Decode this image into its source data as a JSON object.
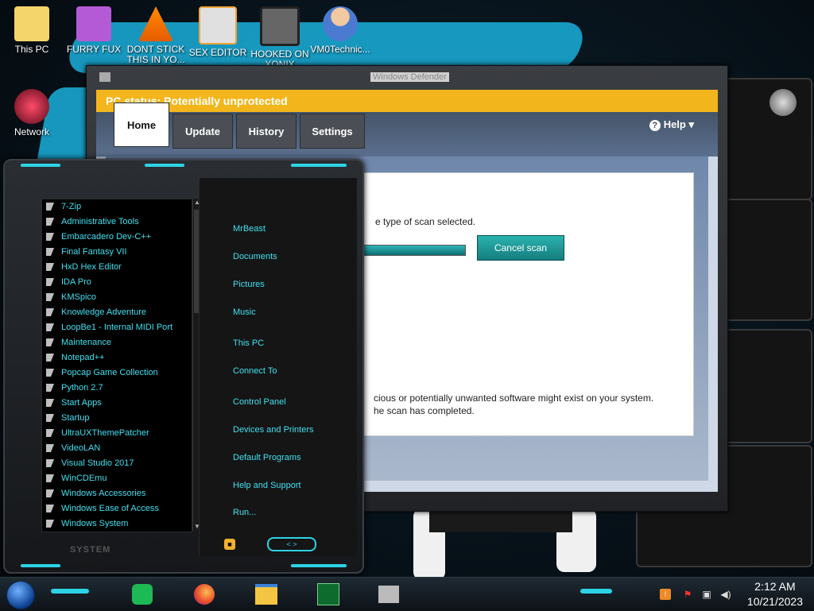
{
  "desktop": {
    "icons": [
      {
        "label": "This PC"
      },
      {
        "label": "FURRY FUX"
      },
      {
        "label": "DONT STICK THIS IN YO..."
      },
      {
        "label": "SEX EDITOR"
      },
      {
        "label": "HOOKED ON XONIX"
      },
      {
        "label": "VM0Technic..."
      },
      {
        "label": "Network"
      }
    ]
  },
  "defender": {
    "title": "Windows Defender",
    "status": "PC status: Potentially unprotected",
    "tabs": [
      "Home",
      "Update",
      "History",
      "Settings"
    ],
    "help": "Help",
    "scan_text": "e type of scan selected.",
    "cancel_label": "Cancel scan",
    "progress": 0.95,
    "warning_line1": "cious or potentially unwanted software might exist on your system.",
    "warning_line2": "he scan has completed."
  },
  "start_menu": {
    "programs": [
      "7-Zip",
      "Administrative Tools",
      "Embarcadero Dev-C++",
      "Final Fantasy VII",
      "HxD Hex Editor",
      "IDA Pro",
      "KMSpico",
      "Knowledge Adventure",
      "LoopBe1 - Internal MIDI Port",
      "Maintenance",
      "Notepad++",
      "Popcap Game Collection",
      "Python 2.7",
      "Start Apps",
      "Startup",
      "UltraUXThemePatcher",
      "VideoLAN",
      "Visual Studio 2017",
      "WinCDEmu",
      "Windows Accessories",
      "Windows Ease of Access",
      "Windows System"
    ],
    "places": [
      "MrBeast",
      "Documents",
      "Pictures",
      "Music",
      "This PC",
      "Connect To",
      "Control Panel",
      "Devices and Printers",
      "Default Programs",
      "Help and Support",
      "Run..."
    ],
    "system_label": "SYSTEM",
    "power_label": "<  >"
  },
  "taskbar": {
    "apps": [
      "spotify-icon",
      "firefox-icon",
      "explorer-icon",
      "taskmanager-icon",
      "xonix-icon"
    ],
    "time": "2:12 AM",
    "date": "10/21/2023"
  }
}
